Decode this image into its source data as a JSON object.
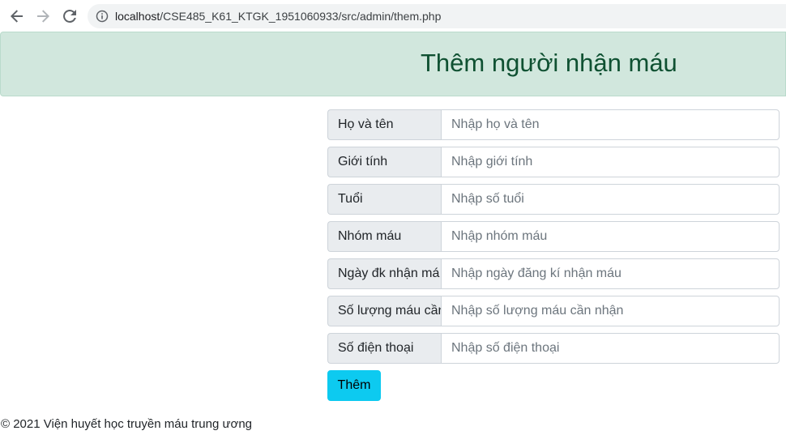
{
  "browser": {
    "url_host": "localhost",
    "url_path": "/CSE485_K61_KTGK_1951060933/src/admin/them.php"
  },
  "header": {
    "title": "Thêm người nhận máu"
  },
  "form": {
    "rows": [
      {
        "label": "Họ và tên",
        "placeholder": "Nhập họ và tên"
      },
      {
        "label": "Giới tính",
        "placeholder": "Nhập giới tính"
      },
      {
        "label": "Tuổi",
        "placeholder": "Nhập số tuổi"
      },
      {
        "label": "Nhóm máu",
        "placeholder": "Nhập nhóm máu"
      },
      {
        "label": "Ngày đk nhận má",
        "placeholder": "Nhập ngày đăng kí nhận máu"
      },
      {
        "label": "Số lượng máu cần",
        "placeholder": "Nhập số lượng máu cần nhận"
      },
      {
        "label": "Số điện thoại",
        "placeholder": "Nhập số điện thoại"
      }
    ],
    "submit_label": "Thêm"
  },
  "footer": {
    "text": "© 2021 Viện huyết học truyền máu trung ương"
  },
  "colors": {
    "header_bg": "#d1e7dd",
    "header_text": "#0f5132",
    "button_bg": "#0dcaf0",
    "label_bg": "#e9ecef"
  },
  "icons": {
    "back": "arrow-left-icon",
    "forward": "arrow-right-icon",
    "reload": "reload-icon",
    "info": "info-icon"
  }
}
